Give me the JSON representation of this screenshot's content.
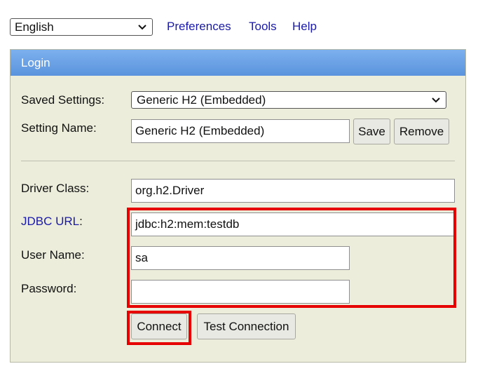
{
  "header": {
    "language": "English",
    "links": [
      "Preferences",
      "Tools",
      "Help"
    ]
  },
  "panel": {
    "title": "Login",
    "saved_settings_label": "Saved Settings:",
    "saved_settings_value": "Generic H2 (Embedded)",
    "setting_name_label": "Setting Name:",
    "setting_name_value": "Generic H2 (Embedded)",
    "save_label": "Save",
    "remove_label": "Remove",
    "driver_class_label": "Driver Class:",
    "driver_class_value": "org.h2.Driver",
    "jdbc_url_label": "JDBC URL",
    "jdbc_url_colon": ":",
    "jdbc_url_value": "jdbc:h2:mem:testdb",
    "user_name_label": "User Name:",
    "user_name_value": "sa",
    "password_label": "Password:",
    "password_value": "",
    "connect_label": "Connect",
    "test_connection_label": "Test Connection"
  },
  "colors": {
    "panel_bg": "#ededdc",
    "header_blue": "#6aa1e6",
    "link_blue": "#1a1aa6",
    "highlight_red": "#e60000"
  }
}
